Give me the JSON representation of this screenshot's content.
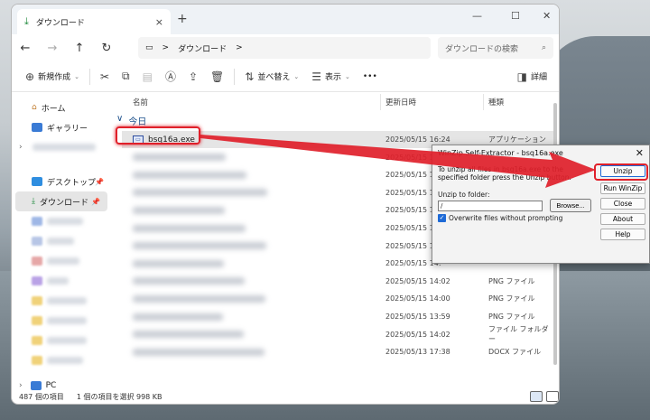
{
  "window": {
    "tab_title": "ダウンロード",
    "tab_close": "×",
    "new_tab": "+",
    "minimize": "—",
    "maximize": "☐",
    "close": "✕"
  },
  "address": {
    "breadcrumb_sep": ">",
    "location": "ダウンロード",
    "search_placeholder": "ダウンロードの検索"
  },
  "toolbar": {
    "new": "新規作成",
    "sort": "並べ替え",
    "view": "表示",
    "more": "•••",
    "details": "詳細"
  },
  "sidebar": {
    "home": "ホーム",
    "gallery": "ギャラリー",
    "desktop": "デスクトップ",
    "downloads": "ダウンロード",
    "pc": "PC"
  },
  "columns": {
    "name": "名前",
    "date": "更新日時",
    "type": "種類"
  },
  "group": {
    "label": "今日",
    "chevron": "∨"
  },
  "files": [
    {
      "name": "bsq16a.exe",
      "date": "2025/05/15 16:24",
      "type": "アプリケーション"
    },
    {
      "name": "",
      "date": "2025/05/15 16:",
      "type": ""
    },
    {
      "name": "",
      "date": "2025/05/15 16:",
      "type": ""
    },
    {
      "name": "",
      "date": "2025/05/15 16:",
      "type": ""
    },
    {
      "name": "",
      "date": "2025/05/15 15:",
      "type": ""
    },
    {
      "name": "",
      "date": "2025/05/15 14:",
      "type": ""
    },
    {
      "name": "",
      "date": "2025/05/15 14:",
      "type": ""
    },
    {
      "name": "",
      "date": "2025/05/15 14:",
      "type": ""
    },
    {
      "name": "",
      "date": "2025/05/15 14:02",
      "type": "PNG ファイル"
    },
    {
      "name": "",
      "date": "2025/05/15 14:00",
      "type": "PNG ファイル"
    },
    {
      "name": "",
      "date": "2025/05/15 13:59",
      "type": "PNG ファイル"
    },
    {
      "name": "",
      "date": "2025/05/15 14:02",
      "type": "ファイル フォルダー"
    },
    {
      "name": "",
      "date": "2025/05/13 17:38",
      "type": "DOCX ファイル"
    }
  ],
  "status": {
    "count": "487 個の項目",
    "selection": "1 個の項目を選択  998 KB"
  },
  "dialog": {
    "title": "WinZip Self-Extractor - bsq16a.exe",
    "close": "✕",
    "instructions": "To unzip all files in bsq16a.exe to the specified folder press the Unzip button.",
    "unzip_to_label": "Unzip to folder:",
    "folder_value": "/",
    "browse": "Browse...",
    "overwrite_label": "Overwrite files without prompting",
    "overwrite_checked": true,
    "buttons": {
      "unzip": "Unzip",
      "run_winzip": "Run WinZip",
      "close": "Close",
      "about": "About",
      "help": "Help"
    }
  },
  "annotation": {
    "color": "#e0202a"
  }
}
